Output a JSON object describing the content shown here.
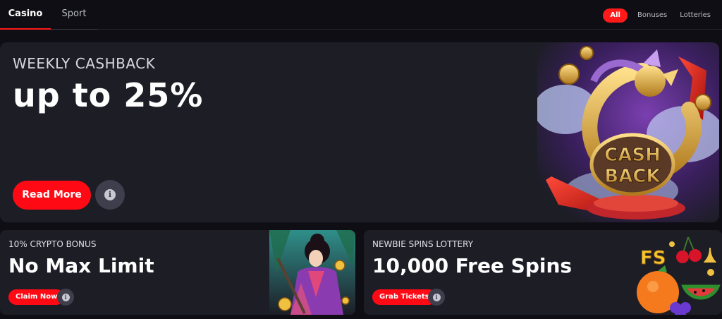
{
  "tabs": {
    "casino": "Casino",
    "sport": "Sport"
  },
  "filters": {
    "all": "All",
    "bonuses": "Bonuses",
    "lotteries": "Lotteries"
  },
  "hero": {
    "kicker": "WEEKLY CASHBACK",
    "title": "up to 25%",
    "button": "Read More",
    "art_line1": "CASH",
    "art_line2": "BACK"
  },
  "cards": [
    {
      "kicker": "10% CRYPTO BONUS",
      "title": "No Max Limit",
      "button": "Claim Now"
    },
    {
      "kicker": "NEWBIE SPINS LOTTERY",
      "title": "10,000 Free Spins",
      "button": "Grab Tickets",
      "art_label": "FS"
    }
  ],
  "colors": {
    "accent": "#ff0a14",
    "background": "#0e0e14",
    "card": "#1d1d26"
  },
  "icons": {
    "info": "info-icon"
  }
}
